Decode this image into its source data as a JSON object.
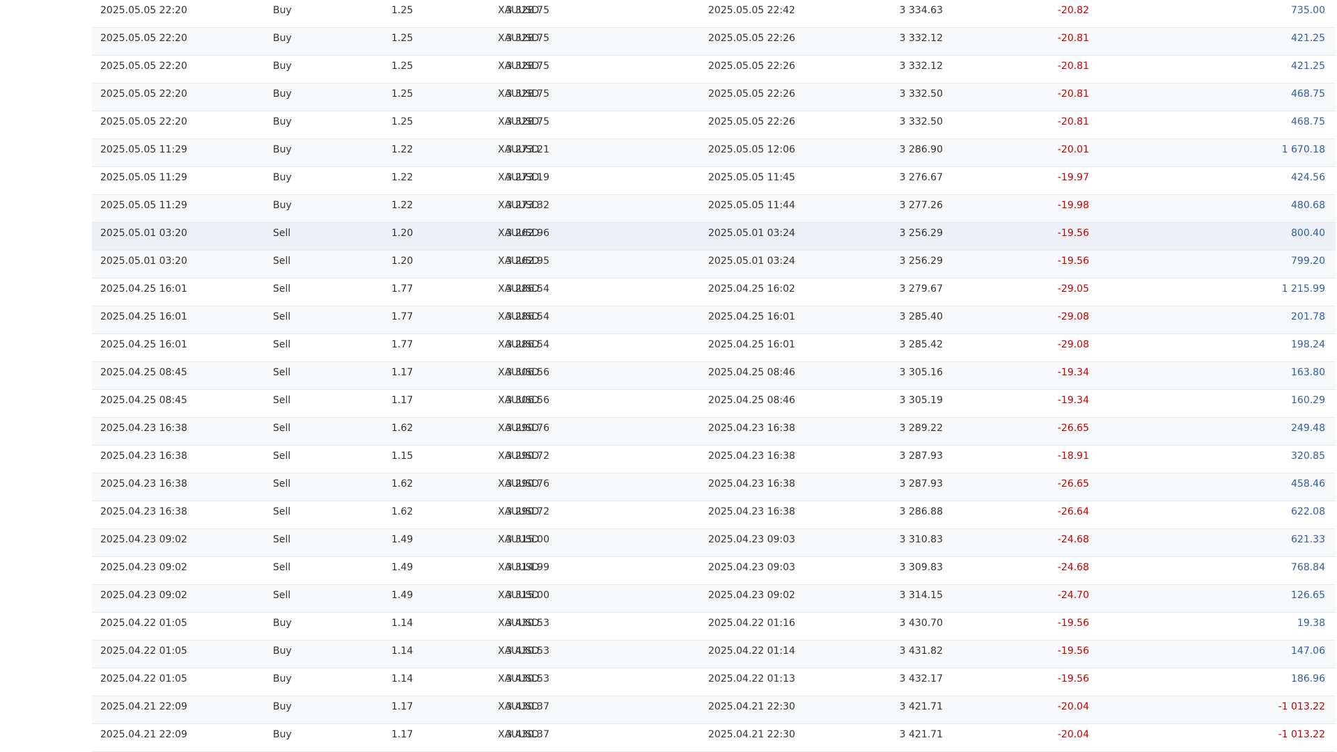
{
  "trades": [
    {
      "open_time": "2025.05.05 22:20",
      "type": "Buy",
      "volume": "1.25",
      "symbol": "XAUUSD",
      "open_price": "3 328.75",
      "close_time": "2025.05.05 22:42",
      "close_price": "3 334.63",
      "commission": "-20.82",
      "profit": "735.00"
    },
    {
      "open_time": "2025.05.05 22:20",
      "type": "Buy",
      "volume": "1.25",
      "symbol": "XAUUSD",
      "open_price": "3 328.75",
      "close_time": "2025.05.05 22:26",
      "close_price": "3 332.12",
      "commission": "-20.81",
      "profit": "421.25"
    },
    {
      "open_time": "2025.05.05 22:20",
      "type": "Buy",
      "volume": "1.25",
      "symbol": "XAUUSD",
      "open_price": "3 328.75",
      "close_time": "2025.05.05 22:26",
      "close_price": "3 332.12",
      "commission": "-20.81",
      "profit": "421.25"
    },
    {
      "open_time": "2025.05.05 22:20",
      "type": "Buy",
      "volume": "1.25",
      "symbol": "XAUUSD",
      "open_price": "3 328.75",
      "close_time": "2025.05.05 22:26",
      "close_price": "3 332.50",
      "commission": "-20.81",
      "profit": "468.75"
    },
    {
      "open_time": "2025.05.05 22:20",
      "type": "Buy",
      "volume": "1.25",
      "symbol": "XAUUSD",
      "open_price": "3 328.75",
      "close_time": "2025.05.05 22:26",
      "close_price": "3 332.50",
      "commission": "-20.81",
      "profit": "468.75"
    },
    {
      "open_time": "2025.05.05 11:29",
      "type": "Buy",
      "volume": "1.22",
      "symbol": "XAUUSD",
      "open_price": "3 273.21",
      "close_time": "2025.05.05 12:06",
      "close_price": "3 286.90",
      "commission": "-20.01",
      "profit": "1 670.18"
    },
    {
      "open_time": "2025.05.05 11:29",
      "type": "Buy",
      "volume": "1.22",
      "symbol": "XAUUSD",
      "open_price": "3 273.19",
      "close_time": "2025.05.05 11:45",
      "close_price": "3 276.67",
      "commission": "-19.97",
      "profit": "424.56"
    },
    {
      "open_time": "2025.05.05 11:29",
      "type": "Buy",
      "volume": "1.22",
      "symbol": "XAUUSD",
      "open_price": "3 273.32",
      "close_time": "2025.05.05 11:44",
      "close_price": "3 277.26",
      "commission": "-19.98",
      "profit": "480.68"
    },
    {
      "open_time": "2025.05.01 03:20",
      "type": "Sell",
      "volume": "1.20",
      "symbol": "XAUUSD",
      "open_price": "3 262.96",
      "close_time": "2025.05.01 03:24",
      "close_price": "3 256.29",
      "commission": "-19.56",
      "profit": "800.40"
    },
    {
      "open_time": "2025.05.01 03:20",
      "type": "Sell",
      "volume": "1.20",
      "symbol": "XAUUSD",
      "open_price": "3 262.95",
      "close_time": "2025.05.01 03:24",
      "close_price": "3 256.29",
      "commission": "-19.56",
      "profit": "799.20"
    },
    {
      "open_time": "2025.04.25 16:01",
      "type": "Sell",
      "volume": "1.77",
      "symbol": "XAUUSD",
      "open_price": "3 286.54",
      "close_time": "2025.04.25 16:02",
      "close_price": "3 279.67",
      "commission": "-29.05",
      "profit": "1 215.99"
    },
    {
      "open_time": "2025.04.25 16:01",
      "type": "Sell",
      "volume": "1.77",
      "symbol": "XAUUSD",
      "open_price": "3 286.54",
      "close_time": "2025.04.25 16:01",
      "close_price": "3 285.40",
      "commission": "-29.08",
      "profit": "201.78"
    },
    {
      "open_time": "2025.04.25 16:01",
      "type": "Sell",
      "volume": "1.77",
      "symbol": "XAUUSD",
      "open_price": "3 286.54",
      "close_time": "2025.04.25 16:01",
      "close_price": "3 285.42",
      "commission": "-29.08",
      "profit": "198.24"
    },
    {
      "open_time": "2025.04.25 08:45",
      "type": "Sell",
      "volume": "1.17",
      "symbol": "XAUUSD",
      "open_price": "3 306.56",
      "close_time": "2025.04.25 08:46",
      "close_price": "3 305.16",
      "commission": "-19.34",
      "profit": "163.80"
    },
    {
      "open_time": "2025.04.25 08:45",
      "type": "Sell",
      "volume": "1.17",
      "symbol": "XAUUSD",
      "open_price": "3 306.56",
      "close_time": "2025.04.25 08:46",
      "close_price": "3 305.19",
      "commission": "-19.34",
      "profit": "160.29"
    },
    {
      "open_time": "2025.04.23 16:38",
      "type": "Sell",
      "volume": "1.62",
      "symbol": "XAUUSD",
      "open_price": "3 290.76",
      "close_time": "2025.04.23 16:38",
      "close_price": "3 289.22",
      "commission": "-26.65",
      "profit": "249.48"
    },
    {
      "open_time": "2025.04.23 16:38",
      "type": "Sell",
      "volume": "1.15",
      "symbol": "XAUUSD",
      "open_price": "3 290.72",
      "close_time": "2025.04.23 16:38",
      "close_price": "3 287.93",
      "commission": "-18.91",
      "profit": "320.85"
    },
    {
      "open_time": "2025.04.23 16:38",
      "type": "Sell",
      "volume": "1.62",
      "symbol": "XAUUSD",
      "open_price": "3 290.76",
      "close_time": "2025.04.23 16:38",
      "close_price": "3 287.93",
      "commission": "-26.65",
      "profit": "458.46"
    },
    {
      "open_time": "2025.04.23 16:38",
      "type": "Sell",
      "volume": "1.62",
      "symbol": "XAUUSD",
      "open_price": "3 290.72",
      "close_time": "2025.04.23 16:38",
      "close_price": "3 286.88",
      "commission": "-26.64",
      "profit": "622.08"
    },
    {
      "open_time": "2025.04.23 09:02",
      "type": "Sell",
      "volume": "1.49",
      "symbol": "XAUUSD",
      "open_price": "3 315.00",
      "close_time": "2025.04.23 09:03",
      "close_price": "3 310.83",
      "commission": "-24.68",
      "profit": "621.33"
    },
    {
      "open_time": "2025.04.23 09:02",
      "type": "Sell",
      "volume": "1.49",
      "symbol": "XAUUSD",
      "open_price": "3 314.99",
      "close_time": "2025.04.23 09:03",
      "close_price": "3 309.83",
      "commission": "-24.68",
      "profit": "768.84"
    },
    {
      "open_time": "2025.04.23 09:02",
      "type": "Sell",
      "volume": "1.49",
      "symbol": "XAUUSD",
      "open_price": "3 315.00",
      "close_time": "2025.04.23 09:02",
      "close_price": "3 314.15",
      "commission": "-24.70",
      "profit": "126.65"
    },
    {
      "open_time": "2025.04.22 01:05",
      "type": "Buy",
      "volume": "1.14",
      "symbol": "XAUUSD",
      "open_price": "3 430.53",
      "close_time": "2025.04.22 01:16",
      "close_price": "3 430.70",
      "commission": "-19.56",
      "profit": "19.38"
    },
    {
      "open_time": "2025.04.22 01:05",
      "type": "Buy",
      "volume": "1.14",
      "symbol": "XAUUSD",
      "open_price": "3 430.53",
      "close_time": "2025.04.22 01:14",
      "close_price": "3 431.82",
      "commission": "-19.56",
      "profit": "147.06"
    },
    {
      "open_time": "2025.04.22 01:05",
      "type": "Buy",
      "volume": "1.14",
      "symbol": "XAUUSD",
      "open_price": "3 430.53",
      "close_time": "2025.04.22 01:13",
      "close_price": "3 432.17",
      "commission": "-19.56",
      "profit": "186.96"
    },
    {
      "open_time": "2025.04.21 22:09",
      "type": "Buy",
      "volume": "1.17",
      "symbol": "XAUUSD",
      "open_price": "3 430.37",
      "close_time": "2025.04.21 22:30",
      "close_price": "3 421.71",
      "commission": "-20.04",
      "profit": "-1 013.22"
    },
    {
      "open_time": "2025.04.21 22:09",
      "type": "Buy",
      "volume": "1.17",
      "symbol": "XAUUSD",
      "open_price": "3 430.37",
      "close_time": "2025.04.21 22:30",
      "close_price": "3 421.71",
      "commission": "-20.04",
      "profit": "-1 013.22"
    }
  ],
  "highlighted_row": 8,
  "colors": {
    "text": "#333333",
    "commission": "#c80000",
    "profit_positive": "#2f5faa",
    "profit_negative": "#c80000",
    "row_alt": "#f7f8f9",
    "row_highlight": "#edf0f4",
    "divider": "#e9ecef"
  }
}
